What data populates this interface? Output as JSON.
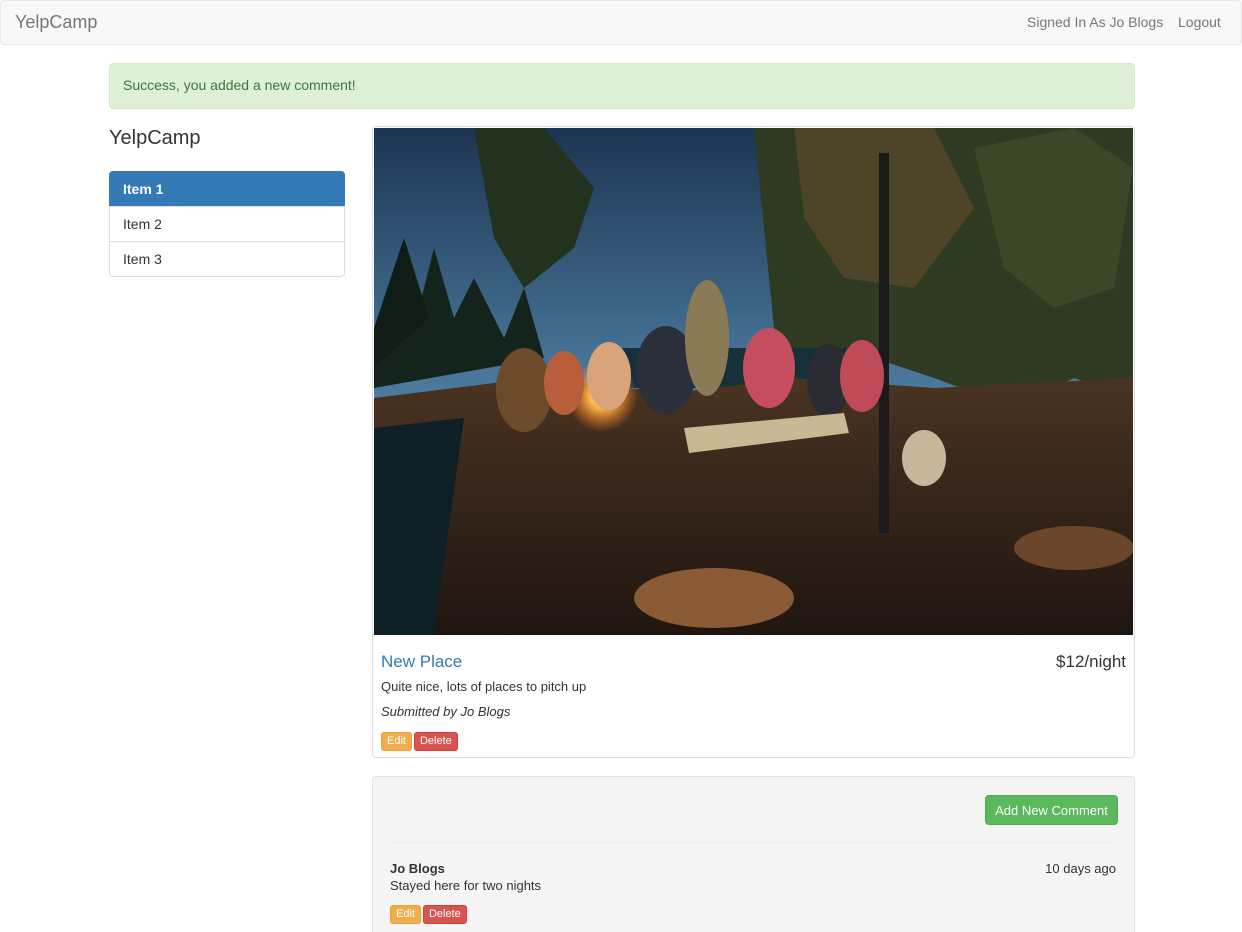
{
  "navbar": {
    "brand": "YelpCamp",
    "user_label": "Signed In As Jo Blogs",
    "logout_label": "Logout"
  },
  "alert": {
    "message": "Success, you added a new comment!"
  },
  "sidebar": {
    "title": "YelpCamp",
    "items": [
      {
        "label": "Item 1",
        "active": true
      },
      {
        "label": "Item 2",
        "active": false
      },
      {
        "label": "Item 3",
        "active": false
      }
    ]
  },
  "campground": {
    "name": "New Place",
    "price": "$12/night",
    "description": "Quite nice, lots of places to pitch up",
    "submitted_by": "Submitted by Jo Blogs",
    "edit_label": "Edit",
    "delete_label": "Delete"
  },
  "comments": {
    "add_label": "Add New Comment",
    "items": [
      {
        "author": "Jo Blogs",
        "time": "10 days ago",
        "text": "Stayed here for two nights",
        "edit_label": "Edit",
        "delete_label": "Delete"
      }
    ]
  },
  "colors": {
    "primary": "#337ab7",
    "success": "#5cb85c",
    "warning": "#f0ad4e",
    "danger": "#d9534f",
    "alert_bg": "#dff0d8"
  }
}
